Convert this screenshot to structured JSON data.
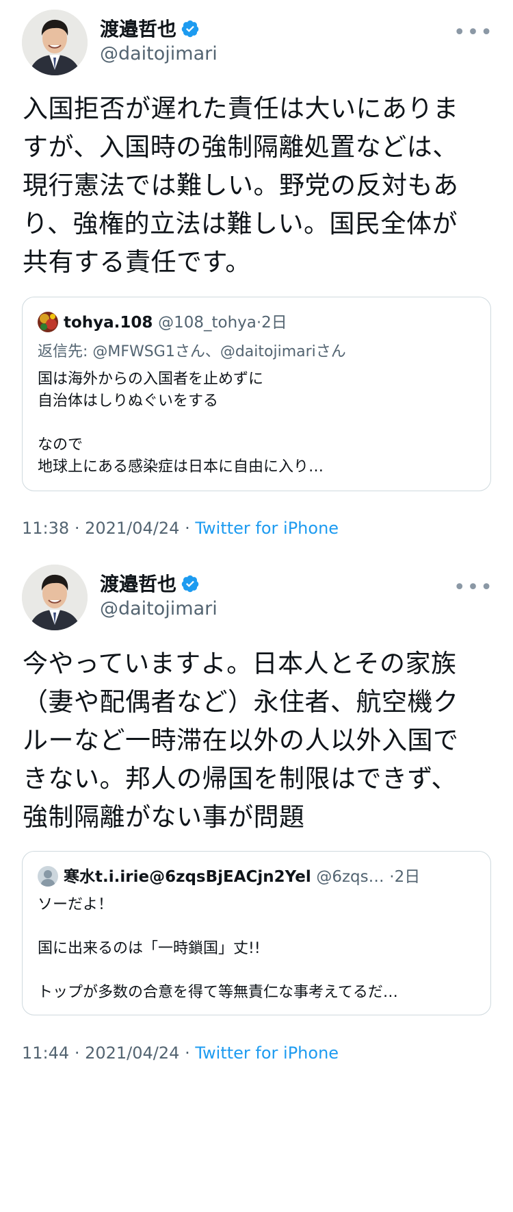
{
  "tweets": [
    {
      "author": {
        "name": "渡邉哲也",
        "handle": "@daitojimari",
        "avatar": "portrait-man-suit",
        "verified": true
      },
      "more_icon": "more-horizontal-icon",
      "text_lines": [
        "入国拒否が遅れた責任は大いにありま",
        "すが、入国時の強制隔離処置などは、",
        "現行憲法では難しい。野党の反対もあ",
        "り、強権的立法は難しい。国民全体が",
        "共有する責任です。"
      ],
      "quote": {
        "name": "tohya.108",
        "handle": "@108_tohya",
        "sep": "·",
        "time": "2日",
        "avatar": "colorful-illustration",
        "reply_label": "返信先:",
        "reply_to": "@MFWSG1さん、@daitojimariさん",
        "lines": [
          "国は海外からの入国者を止めずに",
          "自治体はしりぬぐいをする",
          "",
          "なので",
          "地球上にある感染症は日本に自由に入り…"
        ]
      },
      "time": "11:38",
      "sep": "·",
      "date": "2021/04/24",
      "sep2": "·",
      "app": "Twitter for iPhone"
    },
    {
      "author": {
        "name": "渡邉哲也",
        "handle": "@daitojimari",
        "avatar": "portrait-man-suit",
        "verified": true
      },
      "more_icon": "more-horizontal-icon",
      "text_lines": [
        "今やっていますよ。日本人とその家族",
        "（妻や配偶者など）永住者、航空機ク",
        "ルーなど一時滞在以外の人以外入国で",
        "きない。邦人の帰国を制限はできず、",
        "強制隔離がない事が問題"
      ],
      "quote": {
        "name": "寒水t.i.irie@6zqsBjEACjn2Yel",
        "handle": "@6zqs…",
        "sep": "·",
        "time": "2日",
        "avatar": "default-profile",
        "lines": [
          "ソーだよ！",
          "",
          "国に出来るのは「一時鎖国」丈!!",
          "",
          "トップが多数の合意を得て等無責仁な事考えてるだ…"
        ]
      },
      "time": "11:44",
      "sep": "·",
      "date": "2021/04/24",
      "sep2": "·",
      "app": "Twitter for iPhone"
    }
  ],
  "colors": {
    "link": "#1d9bf0",
    "secondary": "#536471",
    "border": "#cfd9de",
    "text": "#0f1419"
  }
}
